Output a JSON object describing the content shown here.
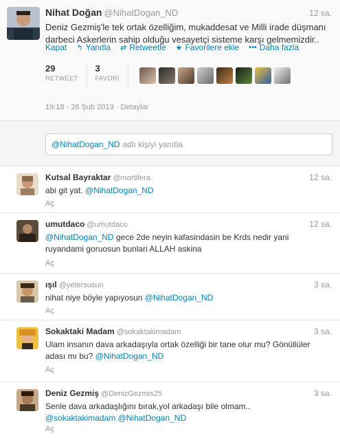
{
  "main": {
    "name": "Nihat Doğan",
    "handle": "@NihatDogan_ND",
    "time": "12 sa.",
    "text": "Deniz Gezmiş'le tek ortak özelliğim, mukaddesat ve Milli irade düşmanı darbeci Askerlerin sahip olduğu vesayetçi sisteme karşı gelmemizdir..",
    "actions": {
      "kapat": "Kapat",
      "reply": "Yanıtla",
      "retweet": "Retweetle",
      "favorite": "Favorilere ekle",
      "more": "Daha fazla"
    },
    "retweet_count": "29",
    "retweet_label": "RETWEET",
    "favorite_count": "3",
    "favorite_label": "FAVORI",
    "timestamp": "19:18 - 26 Şub 2013",
    "details": "Detaylar"
  },
  "reply_box": {
    "mention": "@NihatDogan_ND",
    "placeholder": "adlı kişiyi yanıtla"
  },
  "replies": [
    {
      "name": "Kutsal Bayraktar",
      "handle": "@mortifera",
      "time": "12 sa.",
      "line1_pre": "abi git yat. ",
      "line1_mention": "@NihatDogan_ND",
      "link": "Aç"
    },
    {
      "name": "umutdaco",
      "handle": "@umutdaco",
      "time": "12 sa.",
      "line1_mention": "@NihatDogan_ND",
      "line1_post": " gece 2de neyin kafasindasin be Krds nedir yani",
      "line2": "ruyandami goruosun bunlari ALLAH askina",
      "link": "Aç"
    },
    {
      "name": "ışıl",
      "handle": "@yetersusun",
      "time": "3 sa.",
      "line1_pre": "nihat niye böyle yapıyosun ",
      "line1_mention": "@NihatDogan_ND",
      "link": "Aç"
    },
    {
      "name": "Sokaktaki Madam",
      "handle": "@sokaktakimadam",
      "time": "3 sa.",
      "line1": "Ulam insanın dava arkadaşıyla ortak özelliği bir tane olur mu? Gönüllüler",
      "line2_pre": "adası mı bu? ",
      "line2_mention": "@NihatDogan_ND",
      "link": "Aç"
    },
    {
      "name": "Deniz Gezmiş",
      "handle": "@DenizGezmis25",
      "time": "3 sa.",
      "line1": "Senle dava arkadaşlığını bırak,yol arkadaşı bile olmam..",
      "line2_mention1": "@sokaktakimadam",
      "line2_mention2": "@NihatDogan_ND",
      "link": "Aç"
    }
  ],
  "colors": {
    "link": "#0084b4",
    "muted": "#999999",
    "text": "#333333"
  },
  "icons": {
    "reply": "reply-arrow-icon",
    "retweet": "retweet-icon",
    "favorite": "star-icon",
    "more": "ellipsis-icon"
  }
}
